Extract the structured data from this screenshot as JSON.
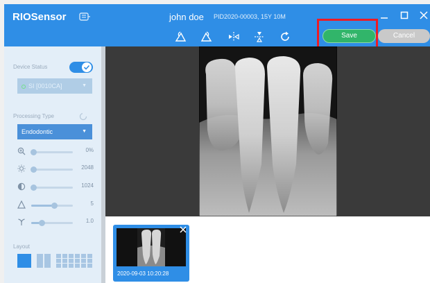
{
  "app": {
    "brand": "RIOSensor"
  },
  "patient": {
    "name": "john doe",
    "info": "PID2020-00003, 15Y 10M"
  },
  "toolbar": {
    "save_label": "Save",
    "cancel_label": "Cancel"
  },
  "sidebar": {
    "device_status_label": "Device Status",
    "device_name": "SI [0010CA]",
    "processing_type_label": "Processing Type",
    "processing_type_value": "Endodontic",
    "sliders": [
      {
        "name": "zoom",
        "value": "0%",
        "level": 0
      },
      {
        "name": "brightness",
        "value": "2048",
        "level": 0
      },
      {
        "name": "contrast",
        "value": "1024",
        "level": 0
      },
      {
        "name": "sharpness",
        "value": "5",
        "level": 0.5
      },
      {
        "name": "gamma",
        "value": "1.0",
        "level": 0.2
      }
    ],
    "layout_label": "Layout"
  },
  "thumbnail": {
    "timestamp": "2020-09-03  10:20:28"
  },
  "colors": {
    "primary": "#2f8ee6",
    "save": "#31b56a",
    "cancel": "#c9c9c9",
    "highlight": "#ee1b24"
  }
}
